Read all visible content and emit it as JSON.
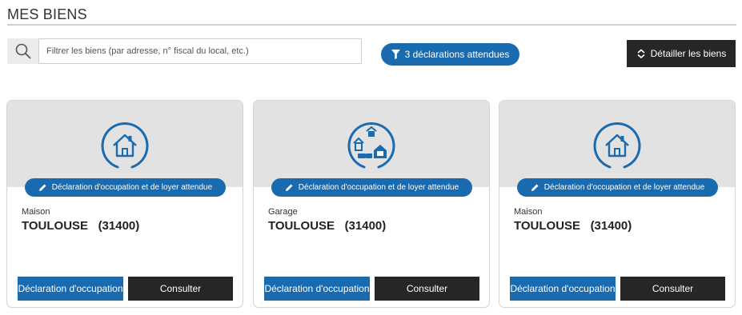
{
  "page": {
    "title": "MES BIENS"
  },
  "search": {
    "placeholder": "Filtrer les biens (par adresse, n° fiscal du local, etc.)",
    "value": "",
    "icon": "search-icon"
  },
  "filter": {
    "label": "3 déclarations attendues",
    "icon": "funnel-icon"
  },
  "detail": {
    "label": "Détailler les biens",
    "icon": "expand-collapse-icon"
  },
  "colors": {
    "accent": "#1a6ab0",
    "dark": "#262626",
    "card_header": "#e2e2e3"
  },
  "cards": [
    {
      "icon": "house-icon",
      "badge": "Déclaration d'occupation et de loyer attendue",
      "type": "Maison",
      "city": "TOULOUSE   (31400)",
      "decl_button": "Déclaration d'occupation",
      "consult_button": "Consulter"
    },
    {
      "icon": "multiple-properties-icon",
      "badge": "Déclaration d'occupation et de loyer attendue",
      "type": "Garage",
      "city": "TOULOUSE   (31400)",
      "decl_button": "Déclaration d'occupation",
      "consult_button": "Consulter"
    },
    {
      "icon": "house-icon",
      "badge": "Déclaration d'occupation et de loyer attendue",
      "type": "Maison",
      "city": "TOULOUSE   (31400)",
      "decl_button": "Déclaration d'occupation",
      "consult_button": "Consulter"
    }
  ]
}
